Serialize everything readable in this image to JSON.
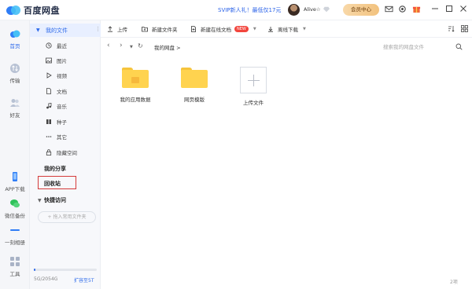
{
  "app": {
    "title": "百度网盘"
  },
  "header": {
    "promo": "SVIP新人礼！最低仅17元",
    "username": "Alive☆",
    "member_button": "会员中心"
  },
  "rail": [
    {
      "label": "首页",
      "icon": "cloud-icon"
    },
    {
      "label": "传输",
      "icon": "transfer-icon"
    },
    {
      "label": "好友",
      "icon": "friends-icon"
    },
    {
      "label": "APP下载",
      "icon": "phone-icon"
    },
    {
      "label": "微信备份",
      "icon": "wechat-icon"
    },
    {
      "label": "一刻相册",
      "icon": "album-icon"
    },
    {
      "label": "工具",
      "icon": "tools-icon"
    }
  ],
  "sidebar": {
    "my_files": "我的文件",
    "items": [
      {
        "label": "最近",
        "icon": "clock-icon"
      },
      {
        "label": "图片",
        "icon": "image-icon"
      },
      {
        "label": "视频",
        "icon": "play-icon"
      },
      {
        "label": "文档",
        "icon": "document-icon"
      },
      {
        "label": "音乐",
        "icon": "music-icon"
      },
      {
        "label": "种子",
        "icon": "torrent-icon"
      },
      {
        "label": "其它",
        "icon": "more-icon"
      },
      {
        "label": "隐藏空间",
        "icon": "lock-icon"
      }
    ],
    "my_share": "我的分享",
    "recycle": "回收站",
    "quick_access": "快捷访问",
    "add_quick": "+ 拖入常用文件夹",
    "quota_text": "5G/2054G",
    "quota_fraction": 0.0024,
    "expand": "扩容至5T"
  },
  "toolbar": {
    "upload": "上传",
    "new_folder": "新建文件夹",
    "new_online_doc": "新建在线文档",
    "new_badge": "NEW",
    "offline_download": "离线下载"
  },
  "nav": {
    "breadcrumb": "我的网盘  >",
    "search_placeholder": "搜索我的网盘文件"
  },
  "files": [
    {
      "name": "我的应用数据",
      "type": "folder"
    },
    {
      "name": "网页模版",
      "type": "folder"
    },
    {
      "name": "上传文件",
      "type": "upload"
    }
  ],
  "status": {
    "count": "2项"
  },
  "colors": {
    "accent": "#2f6bea",
    "folder": "#ffd34f",
    "highlight_box": "#d43a3a",
    "promo": "#2a62e8"
  }
}
